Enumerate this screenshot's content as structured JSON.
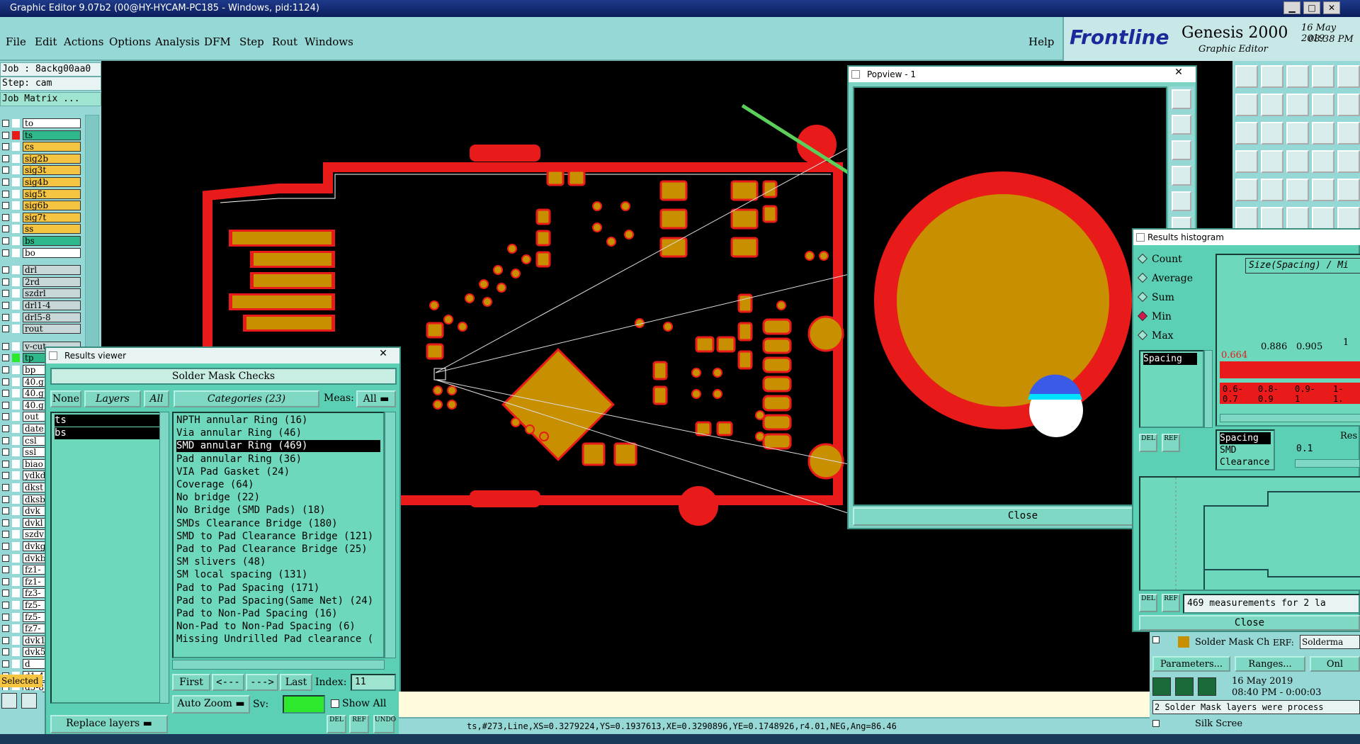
{
  "window": {
    "title": "Graphic Editor 9.07b2 (00@HY-HYCAM-PC185 - Windows, pid:1124)",
    "min": "▁",
    "max": "□",
    "close": "✕"
  },
  "menu": [
    "File",
    "Edit",
    "Actions",
    "Options",
    "Analysis",
    "DFM",
    "Step",
    "Rout",
    "Windows"
  ],
  "help": "Help",
  "brand": {
    "logo": "Frontline",
    "product": "Genesis 2000",
    "subtitle": "Graphic Editor",
    "date": "16 May 2019",
    "time": "08:38 PM"
  },
  "job": {
    "job": "Job : 8ackg00aa0",
    "step": "Step: cam",
    "matrix": "Job Matrix ..."
  },
  "layers": [
    {
      "name": "to",
      "bg": "#ffffff",
      "col": "#ffffff"
    },
    {
      "name": "ts",
      "bg": "#2fb88c",
      "col": "#e81a1a"
    },
    {
      "name": "cs",
      "bg": "#f5c542",
      "col": "#ffffff"
    },
    {
      "name": "sig2b",
      "bg": "#f5c542",
      "col": "#ffffff"
    },
    {
      "name": "sig3t",
      "bg": "#f5c542",
      "col": "#ffffff"
    },
    {
      "name": "sig4b",
      "bg": "#f5c542",
      "col": "#ffffff"
    },
    {
      "name": "sig5t",
      "bg": "#f5c542",
      "col": "#ffffff"
    },
    {
      "name": "sig6b",
      "bg": "#f5c542",
      "col": "#ffffff"
    },
    {
      "name": "sig7t",
      "bg": "#f5c542",
      "col": "#ffffff"
    },
    {
      "name": "ss",
      "bg": "#f5c542",
      "col": "#ffffff"
    },
    {
      "name": "bs",
      "bg": "#2fb88c",
      "col": "#ffffff"
    },
    {
      "name": "bo",
      "bg": "#ffffff",
      "col": "#ffffff"
    }
  ],
  "drill_layers": [
    "drl",
    "2rd",
    "szdrl",
    "drl1-4",
    "drl5-8",
    "rout"
  ],
  "misc_layers": [
    "v-cut",
    "tp",
    "bp",
    "40.g",
    "40.g",
    "40.g",
    "out",
    "date",
    "csl",
    "ssl",
    "biao",
    "ydkd",
    "dkst",
    "dksb",
    "dvk",
    "dvkl",
    "szdv",
    "dvkg",
    "dvkb",
    "fz1-",
    "fz1-",
    "fz3-",
    "fz5-",
    "fz5-",
    "fz7-",
    "dvk1",
    "dvk5",
    "d",
    "d1-4",
    "d5-8"
  ],
  "selected": "Selected",
  "results_viewer": {
    "title": "Results viewer",
    "section": "Solder Mask Checks",
    "none": "None",
    "layers_btn": "Layers",
    "all": "All",
    "categories_btn": "Categories (23)",
    "meas_label": "Meas:",
    "meas_value": "All",
    "layers": [
      "ts",
      "bs"
    ],
    "categories": [
      "NPTH annular Ring (16)",
      "Via annular Ring (46)",
      "SMD annular Ring (469)",
      "Pad annular Ring (36)",
      "VIA Pad Gasket (24)",
      "Coverage (64)",
      "No bridge (22)",
      "No Bridge (SMD Pads) (18)",
      "SMDs Clearance Bridge (180)",
      "SMD to Pad Clearance Bridge (121)",
      "Pad to Pad Clearance Bridge (25)",
      "SM slivers (48)",
      "SM local spacing (131)",
      "Pad to Pad Spacing (171)",
      "Pad to Pad Spacing(Same Net) (24)",
      "Pad to Non-Pad Spacing (16)",
      "Non-Pad to Non-Pad Spacing (6)",
      "Missing Undrilled Pad clearance ("
    ],
    "selected_index": 2,
    "first": "First",
    "prev": "<---",
    "next": "--->",
    "last": "Last",
    "index_label": "Index:",
    "index_value": "11",
    "autozoom": "Auto Zoom",
    "sv": "Sv:",
    "showall": "Show All",
    "replace": "Replace layers",
    "del": "DEL",
    "ref": "REF",
    "undo": "UNDO"
  },
  "popview": {
    "title": "Popview - 1",
    "close": "Close"
  },
  "histogram": {
    "title": "Results histogram",
    "options": [
      "Count",
      "Average",
      "Sum",
      "Min",
      "Max"
    ],
    "selected_option": "Min",
    "spacing": "Spacing",
    "header": "Size(Spacing) / Mi",
    "values": [
      "0.664",
      "0.886",
      "0.905",
      "1"
    ],
    "ranges": [
      "0.6-\n0.7",
      "0.8-\n0.9",
      "0.9-\n1",
      "1-\n1."
    ],
    "types": [
      "Spacing",
      "SMD",
      "Clearance"
    ],
    "res_label": "Res",
    "res_value": "0.1",
    "measurements": "469 measurements for 2 la",
    "close": "Close",
    "del": "DEL",
    "ref": "REF"
  },
  "erf": {
    "name": "Solder Mask Ch",
    "erf_label": "ERF:",
    "erf_value": "Solderma",
    "params": "Parameters...",
    "ranges": "Ranges...",
    "onl": "Onl",
    "date": "16 May 2019",
    "time": "08:40 PM - 0:00:03",
    "message": "2 Solder Mask layers were process",
    "silk": "Silk Scree"
  },
  "status": "ts,#273,Line,XS=0.3279224,YS=0.1937613,XE=0.3290896,YE=0.1748926,r4.01,NEG,Ang=86.46"
}
